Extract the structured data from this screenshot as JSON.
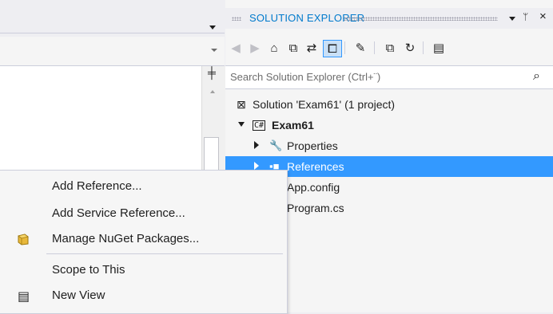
{
  "solution_explorer": {
    "title": "SOLUTION EXPLORER",
    "pin_glyph": "ᛘ",
    "close_glyph": "×",
    "search_placeholder": "Search Solution Explorer (Ctrl+¨)",
    "toolbar": {
      "back_icon": "back-icon",
      "forward_icon": "forward-icon",
      "home_icon": "home-icon",
      "collapse_icon": "collapse-all-icon",
      "sync_icon": "sync-icon",
      "show_all_icon": "show-all-files-icon",
      "properties_icon": "wrench-icon",
      "copy_icon": "pending-changes-icon",
      "refresh_icon": "refresh-icon",
      "view_icon": "new-view-icon"
    },
    "tree": [
      {
        "label": "Solution 'Exam61' (1 project)",
        "icon": "solution-icon"
      },
      {
        "label": "Exam61",
        "icon": "csharp-project-icon"
      },
      {
        "label": "Properties",
        "icon": "wrench-icon"
      },
      {
        "label": "References",
        "icon": "references-icon"
      },
      {
        "label": "App.config",
        "icon": "config-icon"
      },
      {
        "label": "Program.cs",
        "icon": "csharp-file-icon"
      }
    ]
  },
  "context_menu": {
    "items": [
      {
        "label": "Add Reference..."
      },
      {
        "label": "Add Service Reference..."
      },
      {
        "label": "Manage NuGet Packages...",
        "icon": "nuget-icon"
      },
      {
        "label": "Scope to This"
      },
      {
        "label": "New View",
        "icon": "new-view-icon"
      }
    ]
  },
  "colors": {
    "accent": "#007acc",
    "selection": "#3399ff",
    "menu_bg": "#f6f6f6"
  }
}
